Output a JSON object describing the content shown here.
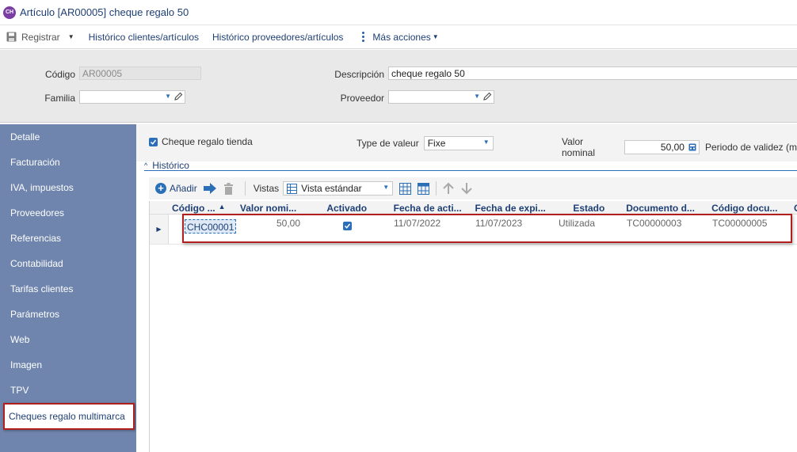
{
  "window": {
    "badge": "CH",
    "title": "Artículo [AR00005] cheque regalo 50"
  },
  "toolbar": {
    "register_label": "Registrar",
    "hist_clients_label": "Histórico clientes/artículos",
    "hist_suppliers_label": "Histórico proveedores/artículos",
    "more_actions_label": "Más acciones"
  },
  "header": {
    "codigo_label": "Código",
    "codigo_value": "AR00005",
    "descripcion_label": "Descripción",
    "descripcion_value": "cheque regalo 50",
    "familia_label": "Familia",
    "familia_value": "",
    "proveedor_label": "Proveedor",
    "proveedor_value": ""
  },
  "sidebar": {
    "items": [
      {
        "label": "Detalle"
      },
      {
        "label": "Facturación"
      },
      {
        "label": "IVA, impuestos"
      },
      {
        "label": "Proveedores"
      },
      {
        "label": "Referencias"
      },
      {
        "label": "Contabilidad"
      },
      {
        "label": "Tarifas clientes"
      },
      {
        "label": "Parámetros"
      },
      {
        "label": "Web"
      },
      {
        "label": "Imagen"
      },
      {
        "label": "TPV"
      },
      {
        "label": "Cheques regalo multimarca"
      }
    ],
    "active_index": 11
  },
  "options": {
    "cheque_tienda_label": "Cheque regalo tienda",
    "type_valeur_label": "Type de valeur",
    "type_valeur_value": "Fixe",
    "valor_nominal_label": "Valor nominal",
    "valor_nominal_value": "50,00",
    "periodo_label": "Periodo de validez (m"
  },
  "historico": {
    "title": "Histórico",
    "add_label": "Añadir",
    "vistas_label": "Vistas",
    "vista_value": "Vista estándar"
  },
  "grid": {
    "columns": [
      "Código ...",
      "Valor nomi...",
      "Activado",
      "Fecha de acti...",
      "Fecha de expi...",
      "Estado",
      "Documento d...",
      "Código docu...",
      "C"
    ],
    "rows": [
      {
        "codigo": "CHC00001",
        "valor": "50,00",
        "activado": true,
        "fecha_act": "11/07/2022",
        "fecha_exp": "11/07/2023",
        "estado": "Utilizada",
        "documento": "TC00000003",
        "codigo_doc": "TC00000005"
      }
    ]
  },
  "colors": {
    "sidebar_bg": "#6f85ad",
    "accent_blue": "#2b6fb8",
    "highlight_red": "#b01e1e",
    "title_text": "#1e3f75"
  }
}
